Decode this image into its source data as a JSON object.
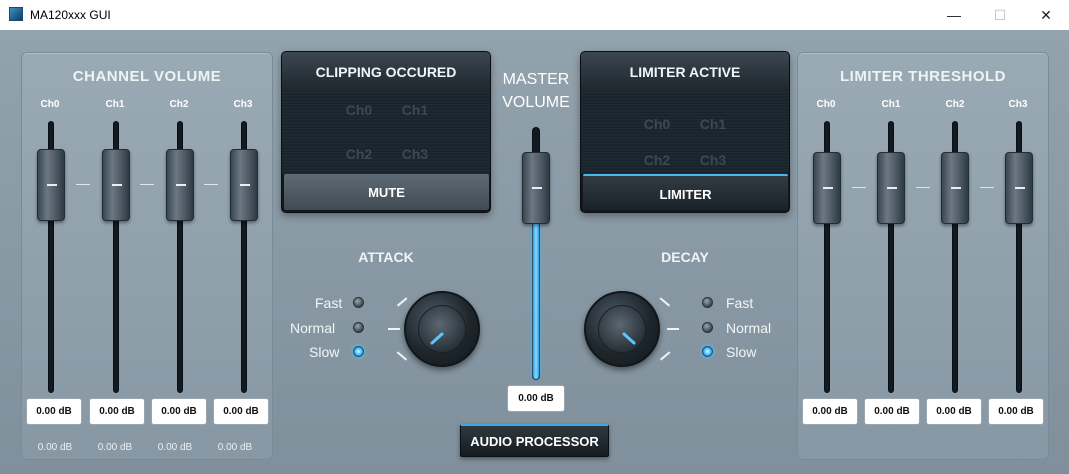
{
  "window": {
    "title": "MA120xxx GUI",
    "minimize": "—",
    "maximize": "☐",
    "close": "✕"
  },
  "channel_volume": {
    "title": "CHANNEL VOLUME",
    "channels": [
      {
        "label": "Ch0",
        "value": "0.00 dB",
        "readout": "0.00 dB"
      },
      {
        "label": "Ch1",
        "value": "0.00 dB",
        "readout": "0.00 dB"
      },
      {
        "label": "Ch2",
        "value": "0.00 dB",
        "readout": "0.00 dB"
      },
      {
        "label": "Ch3",
        "value": "0.00 dB",
        "readout": "0.00 dB"
      }
    ]
  },
  "clipping": {
    "title": "CLIPPING OCCURED",
    "channels": [
      "Ch0",
      "Ch1",
      "Ch2",
      "Ch3"
    ],
    "button": "MUTE"
  },
  "master": {
    "title_line1": "MASTER",
    "title_line2": "VOLUME",
    "value": "0.00 dB",
    "level": 0.73
  },
  "limiter_active": {
    "title": "LIMITER ACTIVE",
    "channels": [
      "Ch0",
      "Ch1",
      "Ch2",
      "Ch3"
    ],
    "button": "LIMITER"
  },
  "limiter_threshold": {
    "title": "LIMITER THRESHOLD",
    "channels": [
      {
        "label": "Ch0",
        "value": "0.00 dB"
      },
      {
        "label": "Ch1",
        "value": "0.00 dB"
      },
      {
        "label": "Ch2",
        "value": "0.00 dB"
      },
      {
        "label": "Ch3",
        "value": "0.00 dB"
      }
    ]
  },
  "attack": {
    "title": "ATTACK",
    "options": [
      "Fast",
      "Normal",
      "Slow"
    ],
    "selected": "Slow"
  },
  "decay": {
    "title": "DECAY",
    "options": [
      "Fast",
      "Normal",
      "Slow"
    ],
    "selected": "Slow"
  },
  "bottom_button": "AUDIO PROCESSOR",
  "colors": {
    "accent": "#47b9f5",
    "background": "#8a9aa6"
  }
}
